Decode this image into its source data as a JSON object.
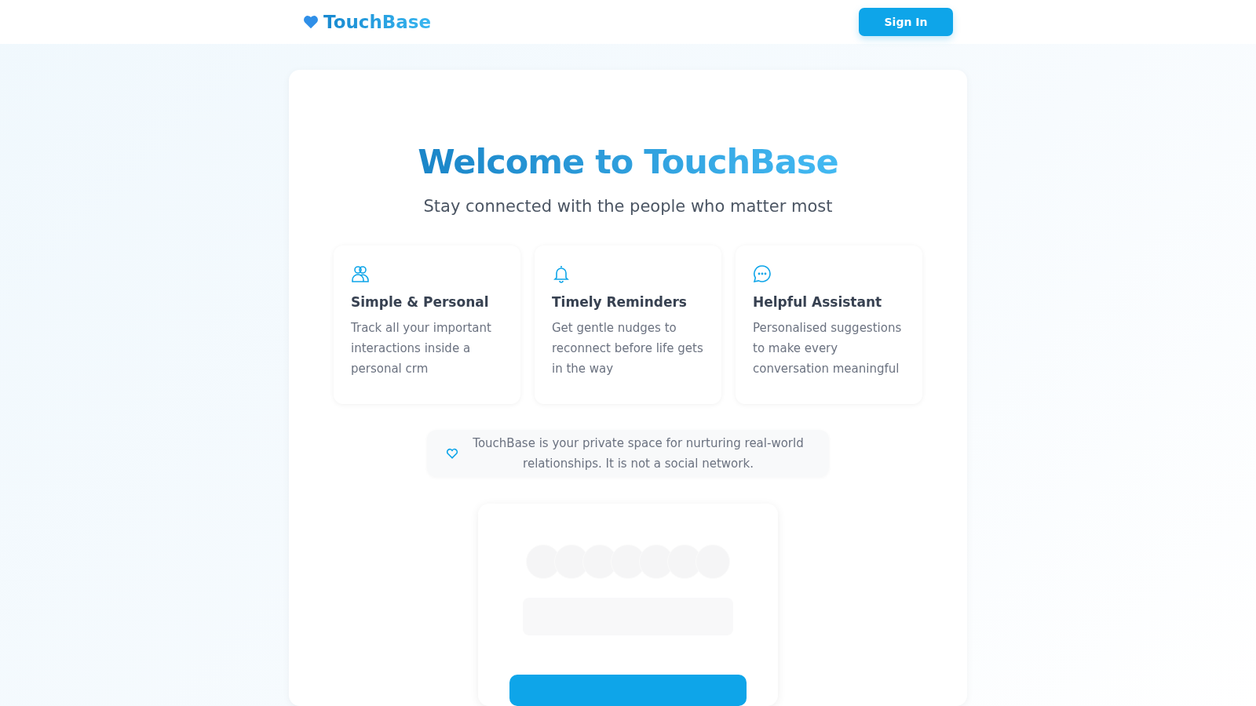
{
  "header": {
    "brand": "TouchBase",
    "sign_in": "Sign In"
  },
  "hero": {
    "title_start": "Welcome to ",
    "title_brand": "TouchBase",
    "subtitle": "Stay connected with the people who matter most"
  },
  "features": [
    {
      "kind": "people",
      "title": "Simple & Personal",
      "text": "Track all your important interactions inside a personal crm"
    },
    {
      "kind": "bell",
      "title": "Timely Reminders",
      "text": "Get gentle nudges to reconnect before life gets in the way"
    },
    {
      "kind": "chat",
      "title": "Helpful Assistant",
      "text": "Personalised suggestions to make every conversation meaningful"
    }
  ],
  "notice": {
    "text": "TouchBase is your private space for nurturing real-world relationships. It is not a social network."
  }
}
